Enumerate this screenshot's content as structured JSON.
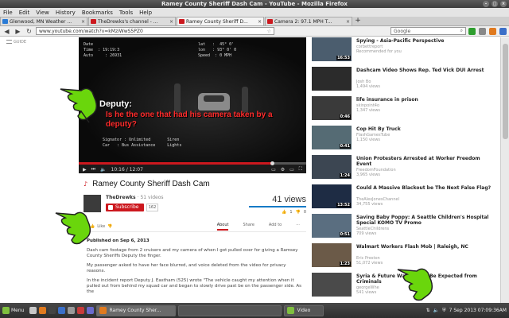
{
  "window": {
    "title": "Ramey County Sheriff Dash Cam - YouTube - Mozilla Firefox"
  },
  "menu": [
    "File",
    "Edit",
    "View",
    "History",
    "Bookmarks",
    "Tools",
    "Help"
  ],
  "tabs": [
    {
      "label": "Glenwood, MN Weather ...",
      "color": "#2a7bd6",
      "active": false
    },
    {
      "label": "TheDrewks's channel - ...",
      "color": "#cc181e",
      "active": false
    },
    {
      "label": "Ramey County Sheriff D...",
      "color": "#cc181e",
      "active": true
    },
    {
      "label": "Camera 2: 97.1 MPH T...",
      "color": "#cc181e",
      "active": false
    }
  ],
  "nav": {
    "url": "www.youtube.com/watch?v=kMziWwS5PZ0",
    "search_placeholder": "Google"
  },
  "guide": {
    "label": "GUIDE"
  },
  "video": {
    "osd_left": "Date\nTime  : 19:19:3\nAuto     : 26931",
    "osd_right": "lat   :  45° 0'\nlon   : 93° 0' 0\nSpeed  : 0 MPH",
    "overlay_title": "Deputy:",
    "overlay_question": "Is he the one that had his camera taken by a deputy?",
    "signature_line": "Signator : Unlimited       Siren\nCar   : Bus Assistance     Lights",
    "time": "10:16 / 12:07",
    "progress": 0.85
  },
  "title": "Ramey County Sheriff Dash Cam",
  "channel": {
    "name": "TheDrewks",
    "video_count": "· 51 videos",
    "subscribe": "Subscribe",
    "sub_count": "162"
  },
  "stats": {
    "views": "41 views",
    "likes": "1",
    "dislikes": "0"
  },
  "actions": {
    "like": "Like",
    "tabs": [
      "About",
      "Share",
      "Add to",
      "···"
    ]
  },
  "description": {
    "published": "Published on Sep 6, 2013",
    "p1": "Dash cam footage from 2 cruisers and my camera of when I got pulled over for giving a Ramsey County Sheriffs Deputy the finger.",
    "p2": "My passenger asked to have her face blurred, and voice deleted from the video for privacy reasons.",
    "p3": "In the incident report Deputy J. Eastham (525) wrote \"The vehicle caught my attention when it pulled out from behind my squad car and began to slowly drive past be on the passenger side. As the"
  },
  "sidebar": [
    {
      "title": "Spying - Asia-Pacific Perspective",
      "channel": "corbettreport",
      "meta": "Recommended for you",
      "duration": "16:53",
      "thumb": "#4b5d6e"
    },
    {
      "title": "Dashcam Video Shows Rep. Ted Vick DUI Arrest",
      "channel": "Josh Bo",
      "meta": "1,494 views",
      "duration": "",
      "thumb": "#2b2b2b"
    },
    {
      "title": "life insurance in prison",
      "channel": "skinpoint4o",
      "meta": "1,347 views",
      "duration": "0:46",
      "thumb": "#3a3a3a"
    },
    {
      "title": "Cop Hit By Truck",
      "channel": "FlashGamesTube",
      "meta": "1,150 views",
      "duration": "0:41",
      "thumb": "#556b74"
    },
    {
      "title": "Union Protesters Arrested at Worker Freedom Event",
      "channel": "FreedomFoundation",
      "meta": "3,965 views",
      "duration": "1:24",
      "thumb": "#3c4652"
    },
    {
      "title": "Could A Massive Blackout be The Next False Flag?",
      "channel": "TheAlexJonesChannel",
      "meta": "34,755 views",
      "duration": "13:52",
      "thumb": "#1e2c44"
    },
    {
      "title": "Saving Baby Poppy: A Seattle Children's Hospital Special KOMO TV Promo",
      "channel": "SeattleChildrens",
      "meta": "709 views",
      "duration": "0:51",
      "thumb": "#5a6e80"
    },
    {
      "title": "Walmart Workers Flash Mob | Raleigh, NC",
      "channel": "Eric Preston",
      "meta": "51,072 views",
      "duration": "1:23",
      "thumb": "#6b5a48"
    },
    {
      "title": "Syria & Future War Should Be Expected from Criminals",
      "channel": "georgeWhe",
      "meta": "541 views",
      "duration": "",
      "thumb": "#4a4a4a"
    }
  ],
  "taskbar": {
    "menu": "Menu",
    "tasks": [
      {
        "label": "Ramey County Sher...",
        "active": true
      },
      {
        "label": "",
        "active": false
      },
      {
        "label": "Video",
        "active": false
      }
    ],
    "clock": "7 Sep 2013 07:09:36AM"
  },
  "colors": {
    "accent": "#cc181e",
    "hand": "#6ad60c"
  }
}
